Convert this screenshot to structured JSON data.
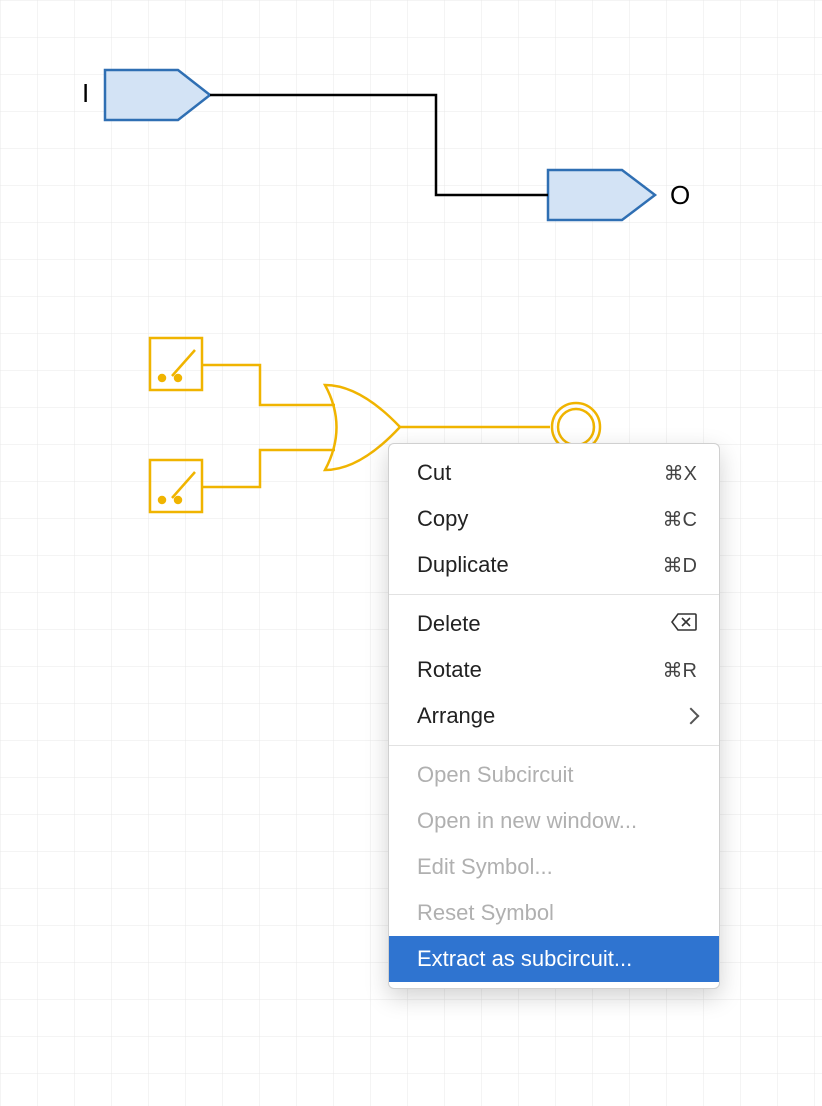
{
  "colors": {
    "grid": "#e9e9e9",
    "pin_fill": "#d3e3f5",
    "pin_stroke": "#2f6fb3",
    "wire": "#000000",
    "selected": "#f0b400",
    "menu_highlight": "#2f74d0"
  },
  "pins": {
    "input_label": "I",
    "output_label": "O"
  },
  "context_menu": {
    "sections": [
      [
        {
          "key": "cut",
          "label": "Cut",
          "shortcut": "⌘X",
          "enabled": true
        },
        {
          "key": "copy",
          "label": "Copy",
          "shortcut": "⌘C",
          "enabled": true
        },
        {
          "key": "duplicate",
          "label": "Duplicate",
          "shortcut": "⌘D",
          "enabled": true
        }
      ],
      [
        {
          "key": "delete",
          "label": "Delete",
          "shortcut_icon": "backspace",
          "enabled": true
        },
        {
          "key": "rotate",
          "label": "Rotate",
          "shortcut": "⌘R",
          "enabled": true
        },
        {
          "key": "arrange",
          "label": "Arrange",
          "submenu": true,
          "enabled": true
        }
      ],
      [
        {
          "key": "open_sub",
          "label": "Open Subcircuit",
          "enabled": false
        },
        {
          "key": "open_new",
          "label": "Open in new window...",
          "enabled": false
        },
        {
          "key": "edit_sym",
          "label": "Edit Symbol...",
          "enabled": false
        },
        {
          "key": "reset_sym",
          "label": "Reset Symbol",
          "enabled": false
        },
        {
          "key": "extract",
          "label": "Extract as subcircuit...",
          "enabled": true,
          "highlight": true
        }
      ]
    ]
  }
}
